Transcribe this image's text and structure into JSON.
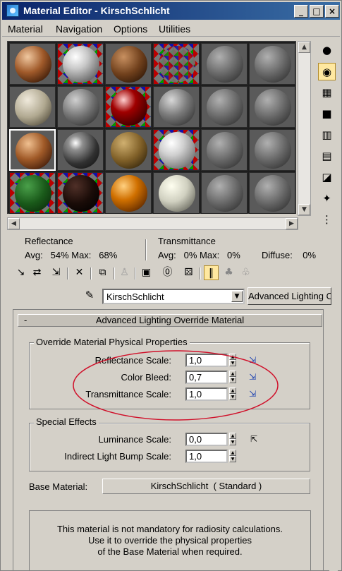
{
  "window": {
    "title": "Material Editor - KirschSchlicht",
    "minimize": "_",
    "maximize": "□",
    "close": "×"
  },
  "menu": [
    "Material",
    "Navigation",
    "Options",
    "Utilities"
  ],
  "stats": {
    "reflectance_label": "Reflectance",
    "reflectance_avg": "Avg:   54% Max:   68%",
    "transmittance_label": "Transmittance",
    "transmittance_avg": "Avg:   0% Max:   0%",
    "diffuse": "Diffuse:    0%"
  },
  "material_name": "KirschSchlicht",
  "material_type_button": "Advanced Lighting Override",
  "rollout": {
    "collapse": "-",
    "title": "Advanced Lighting Override Material"
  },
  "physical_group": {
    "title": "Override Material Physical Properties",
    "reflectance_label": "Reflectance Scale:",
    "reflectance_value": "1,0",
    "color_bleed_label": "Color Bleed:",
    "color_bleed_value": "0,7",
    "transmittance_label": "Transmittance Scale:",
    "transmittance_value": "1,0"
  },
  "special_group": {
    "title": "Special Effects",
    "luminance_label": "Luminance Scale:",
    "luminance_value": "0,0",
    "bump_label": "Indirect Light Bump Scale:",
    "bump_value": "1,0"
  },
  "base_material": {
    "label": "Base Material:",
    "button": "KirschSchlicht  ( Standard )"
  },
  "info_text": [
    "This material is not mandatory for radiosity calculations.",
    "Use it to override the physical properties",
    "of the Base Material when required."
  ],
  "colors": {
    "annotation_ellipse": "#d0102a",
    "title_bar": "#0a246a",
    "active_tool": "#ffe8a0"
  },
  "icons": {
    "sidebar": [
      "sample-type-icon",
      "backlight-icon",
      "background-icon",
      "tiling-icon",
      "video-check-icon",
      "make-preview-icon",
      "options-icon",
      "select-by-material-icon",
      "material-map-navigator-icon"
    ],
    "toolbar": [
      "get-material-icon",
      "put-to-scene-icon",
      "assign-to-selection-icon",
      "reset-icon",
      "make-copy-icon",
      "make-unique-icon",
      "put-to-library-icon",
      "material-id-icon",
      "show-map-in-viewport-icon",
      "show-end-result-icon",
      "go-to-parent-icon",
      "go-forward-to-sibling-icon"
    ]
  }
}
